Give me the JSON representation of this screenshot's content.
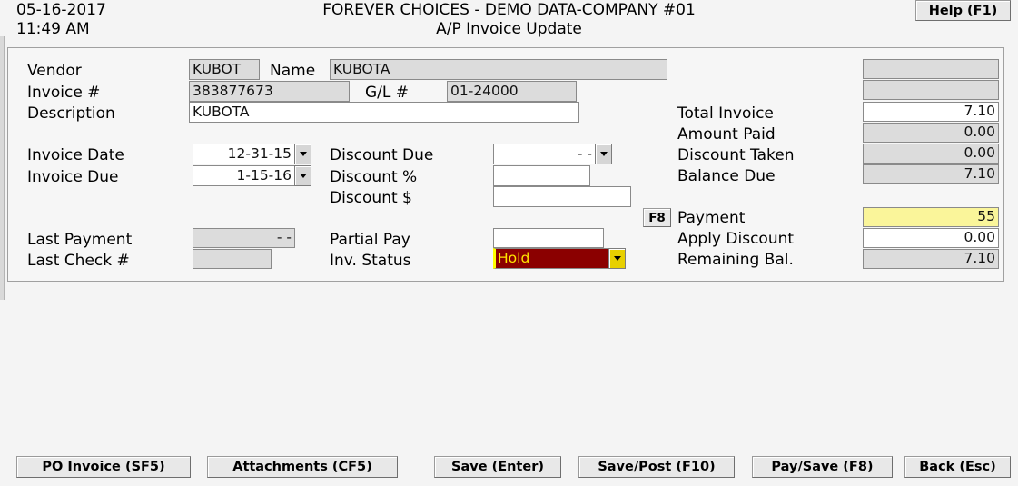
{
  "header": {
    "date": "05-16-2017",
    "time": "11:49 AM",
    "company_title": "FOREVER CHOICES - DEMO DATA-COMPANY #01",
    "screen_title": "A/P Invoice Update",
    "help_button": "Help (F1)"
  },
  "form": {
    "labels": {
      "vendor": "Vendor",
      "name": "Name",
      "invoice_no": "Invoice #",
      "gl_no": "G/L #",
      "description": "Description",
      "invoice_date": "Invoice Date",
      "invoice_due": "Invoice Due",
      "discount_due": "Discount Due",
      "discount_pct": "Discount %",
      "discount_amt": "Discount $",
      "last_payment": "Last Payment",
      "last_check": "Last Check #",
      "partial_pay": "Partial Pay",
      "inv_status": "Inv. Status",
      "total_invoice": "Total Invoice",
      "amount_paid": "Amount Paid",
      "discount_taken": "Discount Taken",
      "balance_due": "Balance Due",
      "payment": "Payment",
      "apply_discount": "Apply Discount",
      "remaining_bal": "Remaining Bal.",
      "f8_tag": "F8"
    },
    "values": {
      "vendor": "KUBOT",
      "name": "KUBOTA",
      "invoice_no": "383877673",
      "gl_no": "01-24000",
      "description": "KUBOTA",
      "invoice_date": "12-31-15",
      "invoice_due": "1-15-16",
      "discount_due": "-  -",
      "discount_pct": "",
      "discount_amt": "",
      "last_payment": "-  -",
      "last_check": "",
      "partial_pay": "",
      "inv_status": "Hold",
      "unlabeled_field_1": "",
      "unlabeled_field_2": "",
      "total_invoice": "7.10",
      "amount_paid": "0.00",
      "discount_taken": "0.00",
      "balance_due": "7.10",
      "payment": "55",
      "apply_discount": "0.00",
      "remaining_bal": "7.10"
    },
    "placeholders": {
      "discount_pct": "",
      "discount_amt": "",
      "partial_pay": ""
    }
  },
  "footer": {
    "buttons": [
      {
        "label": "PO Invoice (SF5)"
      },
      {
        "label": "Attachments (CF5)"
      },
      {
        "label": "Save (Enter)"
      },
      {
        "label": "Save/Post (F10)"
      },
      {
        "label": "Pay/Save (F8)"
      },
      {
        "label": "Back (Esc)"
      }
    ]
  },
  "colors": {
    "status_bg": "#8b0000",
    "status_fg": "#ffe400",
    "focus_field_bg": "#faf59a",
    "disabled_field_bg": "#dcdcdc",
    "page_bg": "#f4f4f4"
  }
}
